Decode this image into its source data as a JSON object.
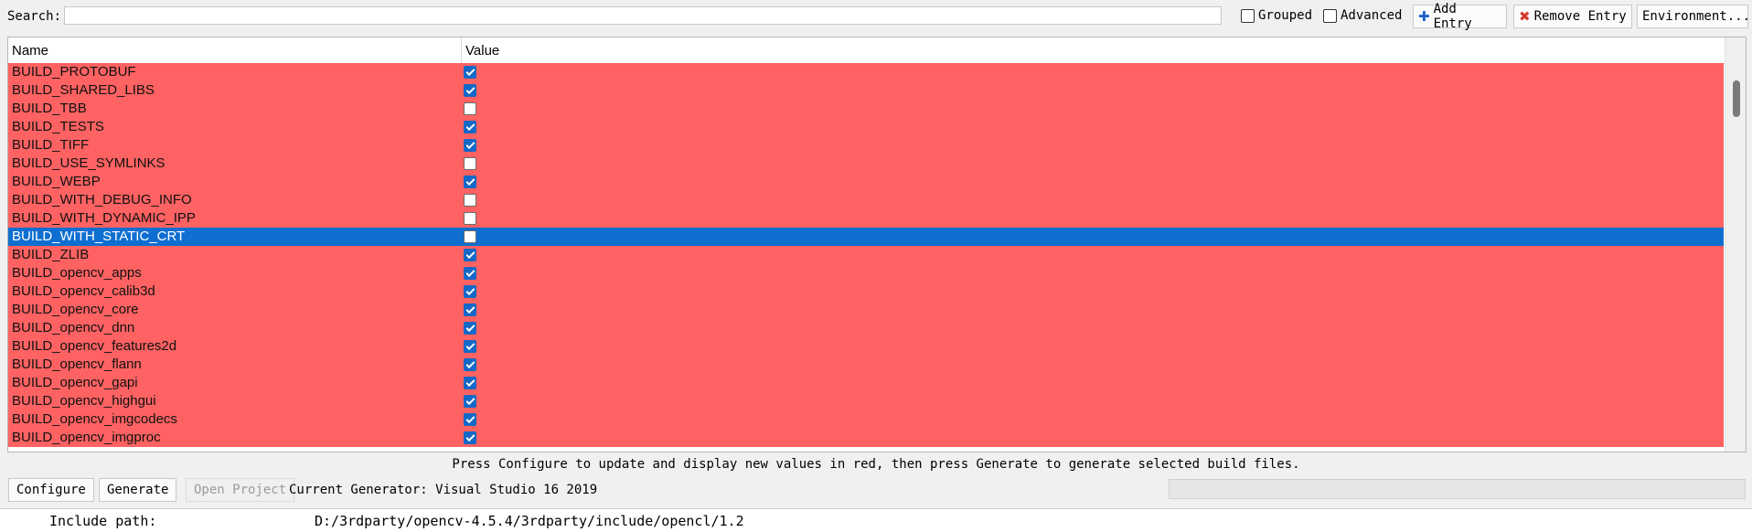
{
  "toolbar": {
    "search_label": "Search:",
    "search_value": "",
    "grouped_label": "Grouped",
    "advanced_label": "Advanced",
    "add_entry_label": "Add Entry",
    "remove_entry_label": "Remove Entry",
    "environment_label": "Environment..."
  },
  "table": {
    "header_name": "Name",
    "header_value": "Value",
    "rows": [
      {
        "name": "BUILD_PROTOBUF",
        "checked": true
      },
      {
        "name": "BUILD_SHARED_LIBS",
        "checked": true
      },
      {
        "name": "BUILD_TBB",
        "checked": false
      },
      {
        "name": "BUILD_TESTS",
        "checked": true
      },
      {
        "name": "BUILD_TIFF",
        "checked": true
      },
      {
        "name": "BUILD_USE_SYMLINKS",
        "checked": false
      },
      {
        "name": "BUILD_WEBP",
        "checked": true
      },
      {
        "name": "BUILD_WITH_DEBUG_INFO",
        "checked": false
      },
      {
        "name": "BUILD_WITH_DYNAMIC_IPP",
        "checked": false
      },
      {
        "name": "BUILD_WITH_STATIC_CRT",
        "checked": false,
        "selected": true
      },
      {
        "name": "BUILD_ZLIB",
        "checked": true
      },
      {
        "name": "BUILD_opencv_apps",
        "checked": true
      },
      {
        "name": "BUILD_opencv_calib3d",
        "checked": true
      },
      {
        "name": "BUILD_opencv_core",
        "checked": true
      },
      {
        "name": "BUILD_opencv_dnn",
        "checked": true
      },
      {
        "name": "BUILD_opencv_features2d",
        "checked": true
      },
      {
        "name": "BUILD_opencv_flann",
        "checked": true
      },
      {
        "name": "BUILD_opencv_gapi",
        "checked": true
      },
      {
        "name": "BUILD_opencv_highgui",
        "checked": true
      },
      {
        "name": "BUILD_opencv_imgcodecs",
        "checked": true
      },
      {
        "name": "BUILD_opencv_imgproc",
        "checked": true
      }
    ]
  },
  "hint_text": "Press Configure to update and display new values in red, then press Generate to generate selected build files.",
  "bottom": {
    "configure_label": "Configure",
    "generate_label": "Generate",
    "open_project_label": "Open Project",
    "current_generator": "Current Generator: Visual Studio 16 2019"
  },
  "output": {
    "key": "Include path:",
    "value": "D:/3rdparty/opencv-4.5.4/3rdparty/include/opencl/1.2"
  },
  "colors": {
    "changed_row": "#ff6262",
    "selected_row": "#0f6fd1",
    "checkbox_checked": "#1468c7"
  }
}
